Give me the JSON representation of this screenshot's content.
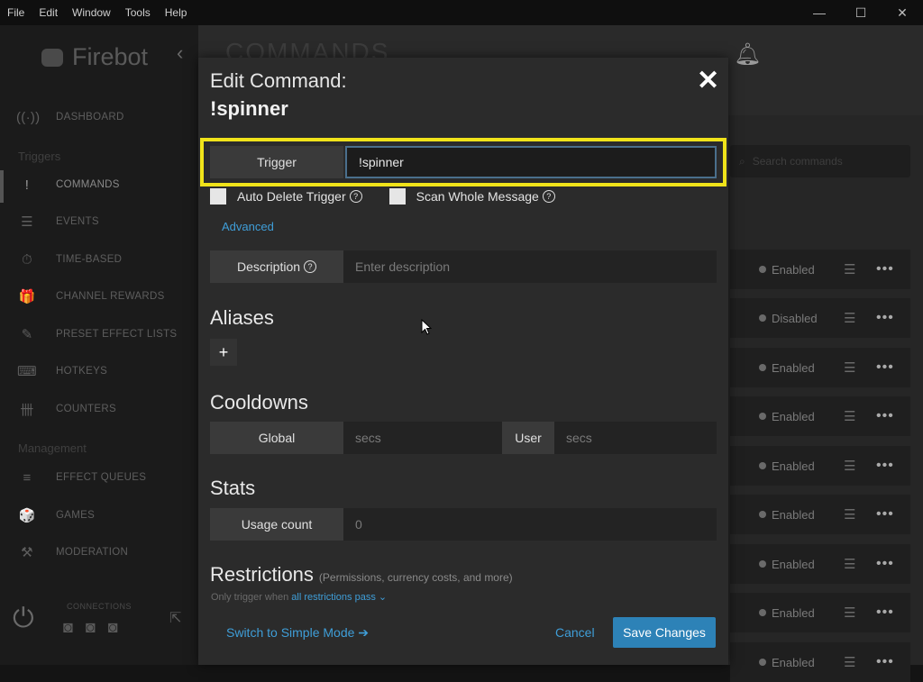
{
  "menubar": [
    "File",
    "Edit",
    "Window",
    "Tools",
    "Help"
  ],
  "window_controls": [
    "—",
    "☐",
    "✕"
  ],
  "sidebar": {
    "brand": "Firebot",
    "collapse": "‹",
    "sections": {
      "triggers": "Triggers",
      "management": "Management"
    },
    "items": [
      {
        "label": "DASHBOARD",
        "icon": "((·))"
      },
      {
        "label": "COMMANDS",
        "icon": "!"
      },
      {
        "label": "EVENTS",
        "icon": "☰"
      },
      {
        "label": "TIME-BASED",
        "icon": "⏱"
      },
      {
        "label": "CHANNEL REWARDS",
        "icon": "🎁"
      },
      {
        "label": "PRESET EFFECT LISTS",
        "icon": "✎"
      },
      {
        "label": "HOTKEYS",
        "icon": "⌨"
      },
      {
        "label": "COUNTERS",
        "icon": "卌"
      },
      {
        "label": "EFFECT QUEUES",
        "icon": "≡"
      },
      {
        "label": "GAMES",
        "icon": "🎲"
      },
      {
        "label": "MODERATION",
        "icon": "⚒"
      }
    ],
    "connections_label": "CONNECTIONS"
  },
  "background": {
    "title": "COMMANDS",
    "search_placeholder": "Search commands",
    "rows": [
      {
        "status": "Enabled"
      },
      {
        "status": "Disabled"
      },
      {
        "status": "Enabled"
      },
      {
        "status": "Enabled"
      },
      {
        "status": "Enabled"
      },
      {
        "status": "Enabled"
      },
      {
        "status": "Enabled"
      },
      {
        "status": "Enabled"
      },
      {
        "status": "Enabled"
      }
    ]
  },
  "modal": {
    "title": "Edit Command:",
    "subtitle": "!spinner",
    "trigger": {
      "label": "Trigger",
      "value": "!spinner"
    },
    "auto_delete": "Auto Delete Trigger",
    "scan_whole": "Scan Whole Message",
    "advanced": "Advanced",
    "description": {
      "label": "Description",
      "placeholder": "Enter description"
    },
    "aliases": {
      "title": "Aliases",
      "add": "+"
    },
    "cooldowns": {
      "title": "Cooldowns",
      "global_label": "Global",
      "global_placeholder": "secs",
      "user_label": "User",
      "user_placeholder": "secs"
    },
    "stats": {
      "title": "Stats",
      "usage_label": "Usage count",
      "usage_value": "0"
    },
    "restrictions": {
      "title": "Restrictions",
      "hint": "(Permissions, currency costs, and more)",
      "only_trigger": "Only trigger when",
      "condition": "all restrictions pass"
    },
    "footer": {
      "simple_mode": "Switch to Simple Mode ➔",
      "cancel": "Cancel",
      "save": "Save Changes"
    }
  },
  "colors": {
    "accent": "#2d82b7",
    "link": "#3f9ed8",
    "highlight": "#f0e31a"
  }
}
